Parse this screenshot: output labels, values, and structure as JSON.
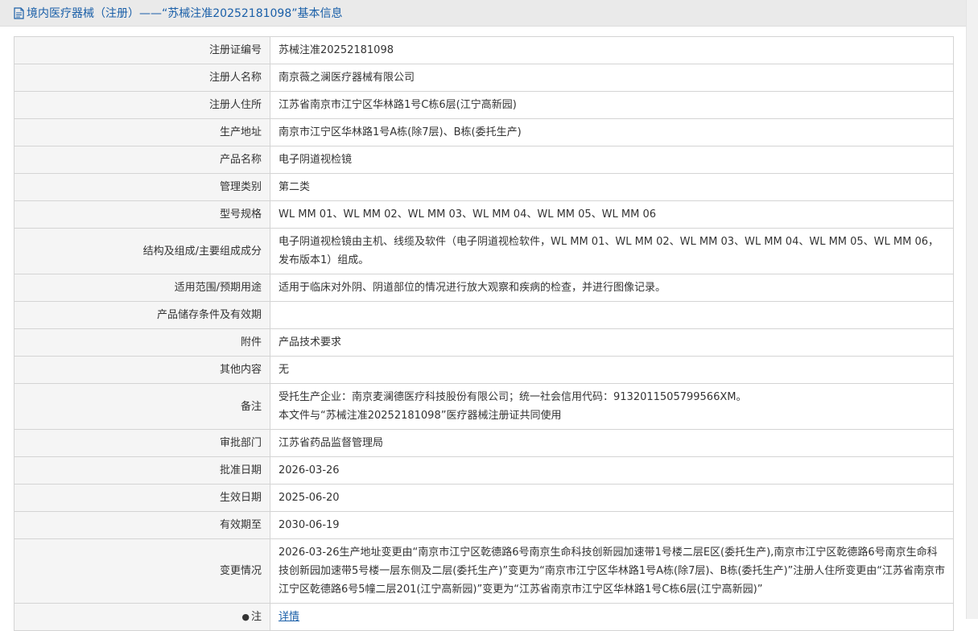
{
  "header": {
    "title": "境内医疗器械（注册）——“苏械注准20252181098”基本信息",
    "icon": "document-icon"
  },
  "rows": [
    {
      "name": "registration-number",
      "label": "注册证编号",
      "lines": [
        "苏械注准20252181098"
      ]
    },
    {
      "name": "registrant-name",
      "label": "注册人名称",
      "lines": [
        "南京薇之澜医疗器械有限公司"
      ]
    },
    {
      "name": "registrant-address",
      "label": "注册人住所",
      "lines": [
        "江苏省南京市江宁区华林路1号C栋6层(江宁高新园)"
      ]
    },
    {
      "name": "production-address",
      "label": "生产地址",
      "lines": [
        "南京市江宁区华林路1号A栋(除7层)、B栋(委托生产)"
      ]
    },
    {
      "name": "product-name",
      "label": "产品名称",
      "lines": [
        "电子阴道视检镜"
      ]
    },
    {
      "name": "management-category",
      "label": "管理类别",
      "lines": [
        "第二类"
      ]
    },
    {
      "name": "model-spec",
      "label": "型号规格",
      "lines": [
        "WL MM 01、WL MM 02、WL MM 03、WL MM 04、WL MM 05、WL MM 06"
      ]
    },
    {
      "name": "structure-composition",
      "label": "结构及组成/主要组成成分",
      "lines": [
        "电子阴道视检镜由主机、线缆及软件（电子阴道视检软件，WL MM 01、WL MM 02、WL MM 03、WL MM 04、WL MM 05、WL MM 06，发布版本1）组成。"
      ]
    },
    {
      "name": "intended-use",
      "label": "适用范围/预期用途",
      "lines": [
        "适用于临床对外阴、阴道部位的情况进行放大观察和疾病的检查，并进行图像记录。"
      ]
    },
    {
      "name": "storage-conditions",
      "label": "产品储存条件及有效期",
      "lines": [
        ""
      ]
    },
    {
      "name": "attachment",
      "label": "附件",
      "lines": [
        "产品技术要求"
      ]
    },
    {
      "name": "other-content",
      "label": "其他内容",
      "lines": [
        "无"
      ]
    },
    {
      "name": "remarks",
      "label": "备注",
      "lines": [
        "受托生产企业：南京麦澜德医疗科技股份有限公司；统一社会信用代码：9132011505799566XM。",
        "本文件与“苏械注准20252181098”医疗器械注册证共同使用"
      ]
    },
    {
      "name": "approval-department",
      "label": "审批部门",
      "lines": [
        "江苏省药品监督管理局"
      ]
    },
    {
      "name": "approval-date",
      "label": "批准日期",
      "lines": [
        "2026-03-26"
      ]
    },
    {
      "name": "effective-date",
      "label": "生效日期",
      "lines": [
        "2025-06-20"
      ]
    },
    {
      "name": "valid-until",
      "label": "有效期至",
      "lines": [
        "2030-06-19"
      ]
    },
    {
      "name": "change-info",
      "label": "变更情况",
      "lines": [
        "2026-03-26生产地址变更由“南京市江宁区乾德路6号南京生命科技创新园加速带1号楼二层E区(委托生产),南京市江宁区乾德路6号南京生命科技创新园加速带5号楼一层东侧及二层(委托生产)”变更为“南京市江宁区华林路1号A栋(除7层)、B栋(委托生产)”注册人住所变更由“江苏省南京市江宁区乾德路6号5幢二层201(江宁高新园)”变更为“江苏省南京市江宁区华林路1号C栋6层(江宁高新园)”"
      ]
    }
  ],
  "note_row": {
    "label": "注",
    "mark": "●",
    "link": "详情"
  }
}
